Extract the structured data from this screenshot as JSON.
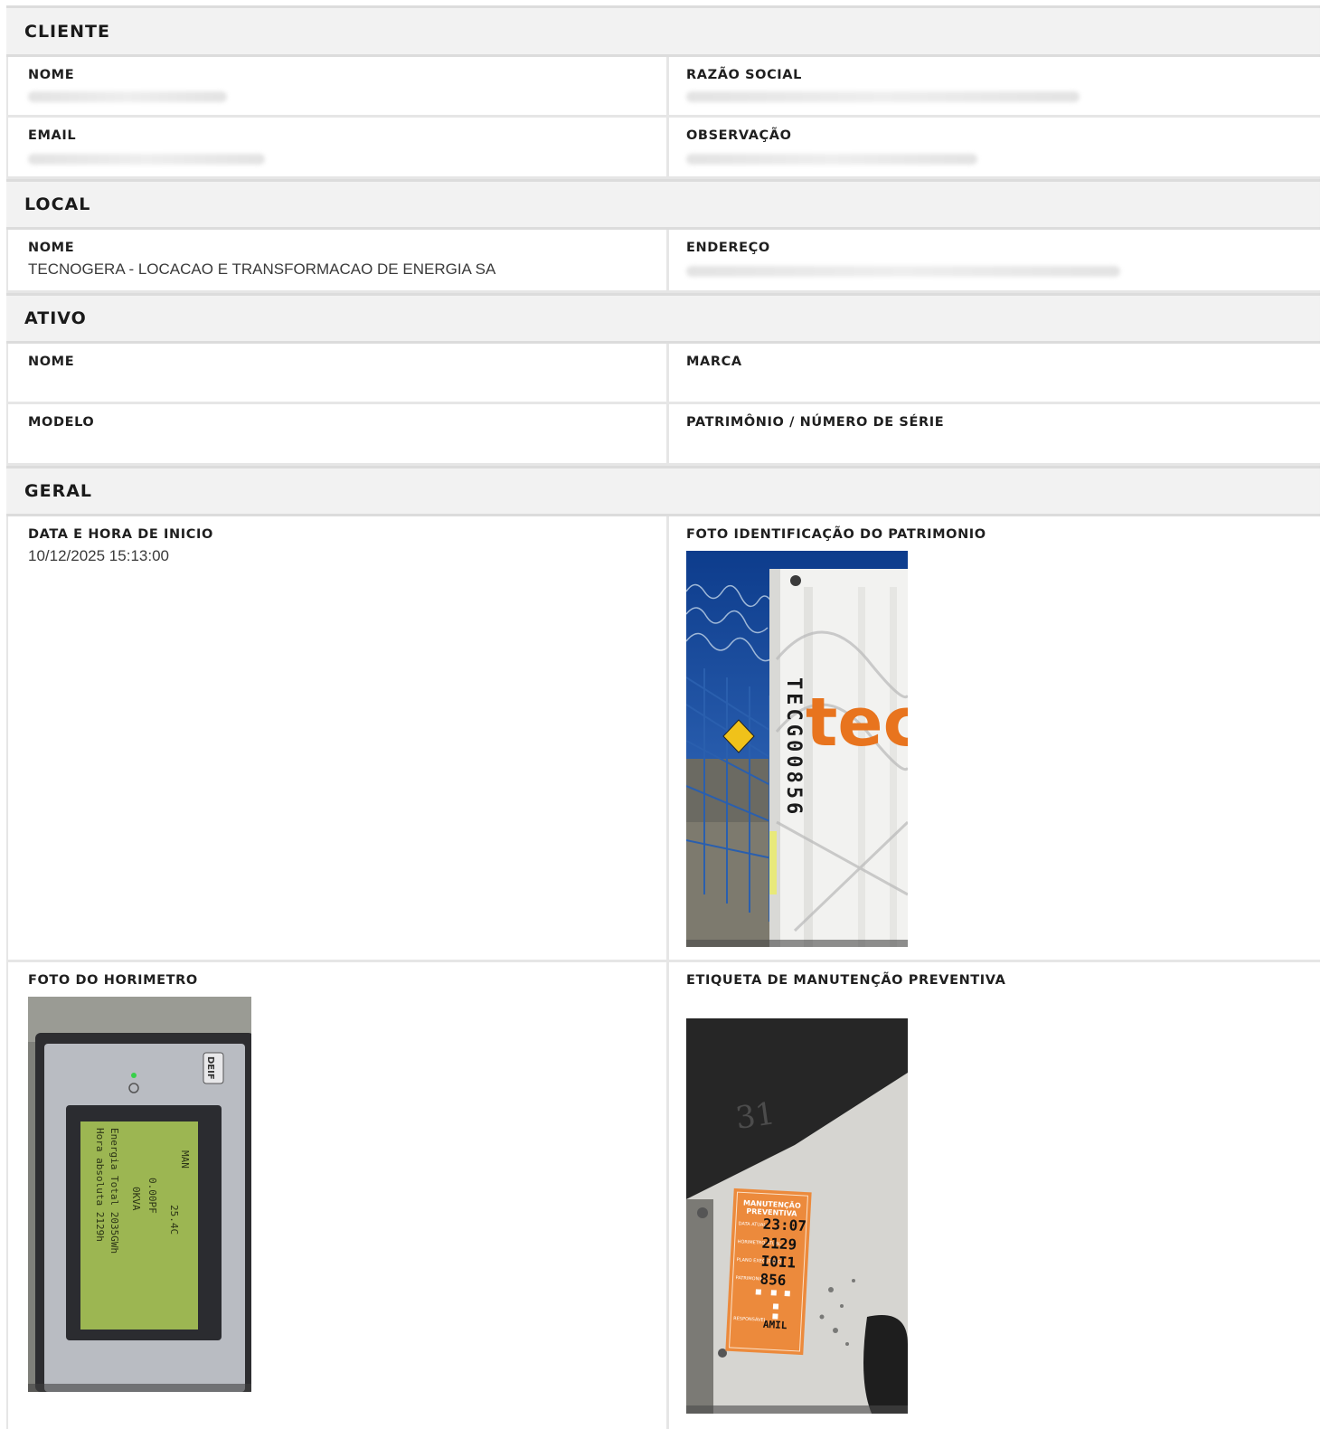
{
  "cliente": {
    "title": "CLIENTE",
    "nome_label": "NOME",
    "razao_label": "RAZÃO SOCIAL",
    "email_label": "EMAIL",
    "observacao_label": "OBSERVAÇÃO"
  },
  "local": {
    "title": "LOCAL",
    "nome_label": "NOME",
    "nome_value": "TECNOGERA - LOCACAO E TRANSFORMACAO DE ENERGIA SA",
    "endereco_label": "ENDEREÇO"
  },
  "ativo": {
    "title": "ATIVO",
    "nome_label": "NOME",
    "marca_label": "MARCA",
    "modelo_label": "MODELO",
    "patrimonio_label": "PATRIMÔNIO / NÚMERO DE SÉRIE"
  },
  "geral": {
    "title": "GERAL",
    "inicio_label": "DATA E HORA DE INICIO",
    "inicio_value": "10/12/2025 15:13:00",
    "foto_patrimonio_label": "FOTO IDENTIFICAÇÃO DO PATRIMONIO",
    "foto_horimetro_label": "FOTO DO HORIMETRO",
    "etiqueta_label": "ETIQUETA DE MANUTENÇÃO PREVENTIVA"
  },
  "photos": {
    "patrimonio": {
      "vertical_text": "TECG00856",
      "logo_text": "tec"
    },
    "horimetro": {
      "brand": "DEIF",
      "lcd_lines": [
        "MAN",
        "25.4C",
        "0.00PF",
        "0KVA",
        "Energia Total 2035GWh",
        "Hora absoluta 2129h"
      ]
    },
    "etiqueta": {
      "title_line1": "MANUTENÇÃO",
      "title_line2": "PREVENTIVA",
      "handwritten_number": "31",
      "rows": [
        {
          "label": "DATA ATUAL",
          "value": "23:07"
        },
        {
          "label": "HORIMETRO ATUAL",
          "value": "2129"
        },
        {
          "label": "PLANO EXECUTADO",
          "value": "I0I1"
        },
        {
          "label": "PATRIMONIO",
          "value": "856"
        },
        {
          "label": "RESPONSÁVEL",
          "value": "AMIL"
        }
      ]
    }
  }
}
